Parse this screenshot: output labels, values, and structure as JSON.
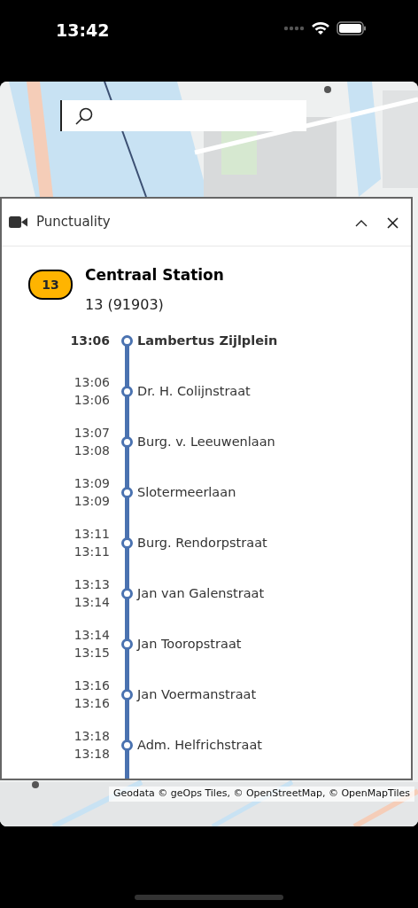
{
  "status_bar": {
    "time": "13:42"
  },
  "search": {
    "kind": "field"
  },
  "panel": {
    "title": "Punctuality",
    "expanded": true,
    "line": {
      "badge": "13",
      "color": "#ffb400",
      "destination": "Centraal Station",
      "trip": "13 (91903)"
    },
    "stops": [
      {
        "kind": "origin",
        "times": [
          "13:06"
        ],
        "name": "Lambertus Zijlplein"
      },
      {
        "kind": "stop",
        "times": [
          "13:06",
          "13:06"
        ],
        "name": "Dr. H. Colijnstraat"
      },
      {
        "kind": "stop",
        "times": [
          "13:07",
          "13:08"
        ],
        "name": "Burg. v. Leeuwenlaan"
      },
      {
        "kind": "stop",
        "times": [
          "13:09",
          "13:09"
        ],
        "name": "Slotermeerlaan"
      },
      {
        "kind": "stop",
        "times": [
          "13:11",
          "13:11"
        ],
        "name": "Burg. Rendorpstraat"
      },
      {
        "kind": "stop",
        "times": [
          "13:13",
          "13:14"
        ],
        "name": "Jan van Galenstraat"
      },
      {
        "kind": "stop",
        "times": [
          "13:14",
          "13:15"
        ],
        "name": "Jan Tooropstraat"
      },
      {
        "kind": "stop",
        "times": [
          "13:16",
          "13:16"
        ],
        "name": "Jan Voermanstraat"
      },
      {
        "kind": "stop",
        "times": [
          "13:18",
          "13:18"
        ],
        "name": "Adm. Helfrichstraat"
      }
    ]
  },
  "attribution": "Geodata © geOps Tiles, © OpenStreetMap, © OpenMapTiles"
}
